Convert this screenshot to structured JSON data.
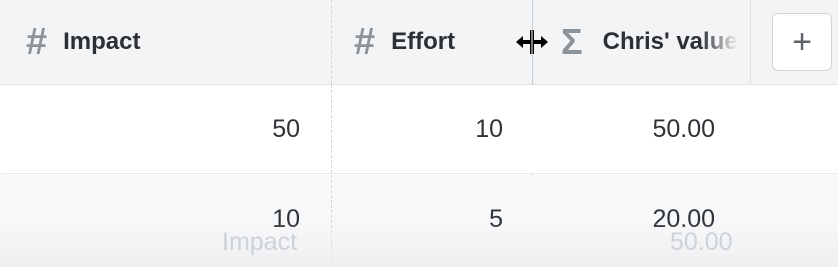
{
  "columns": [
    {
      "label": "Impact",
      "icon": "hash-icon",
      "glyph": "#"
    },
    {
      "label": "Effort",
      "icon": "hash-icon",
      "glyph": "#"
    },
    {
      "label": "Chris' value",
      "icon": "sigma-icon",
      "glyph": "Σ"
    }
  ],
  "add_column": {
    "glyph": "+"
  },
  "rows": [
    {
      "impact": "50",
      "effort": "10",
      "chris_value": "50.00"
    },
    {
      "impact": "10",
      "effort": "5",
      "chris_value": "20.00"
    }
  ],
  "drag_ghost": {
    "label": "Impact",
    "value": "50.00"
  },
  "colors": {
    "header_bg": "#f3f4f5",
    "text": "#2f3337",
    "icon": "#8b939b",
    "border": "#d3d6da"
  }
}
